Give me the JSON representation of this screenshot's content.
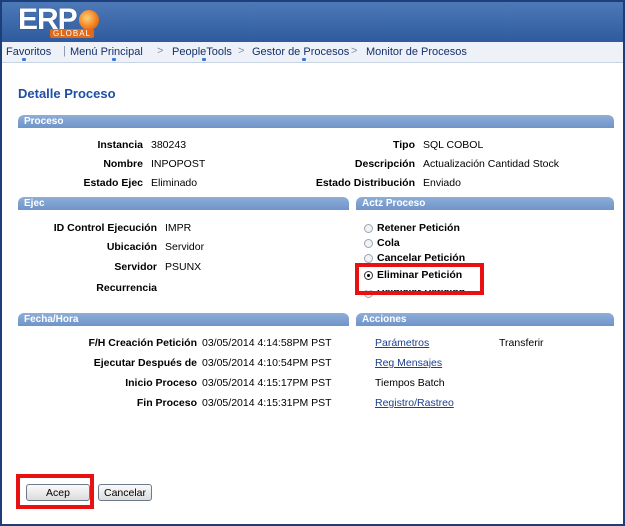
{
  "logo": {
    "text": "ERP",
    "sub": "GLOBAL"
  },
  "breadcrumb": [
    "Favoritos",
    "Menú Principal",
    "PeopleTools",
    "Gestor de Procesos",
    "Monitor de Procesos"
  ],
  "page_title": "Detalle Proceso",
  "proceso": {
    "header": "Proceso",
    "instancia_label": "Instancia",
    "instancia_value": "380243",
    "nombre_label": "Nombre",
    "nombre_value": "INPOPOST",
    "estado_ejec_label": "Estado Ejec",
    "estado_ejec_value": "Eliminado",
    "tipo_label": "Tipo",
    "tipo_value": "SQL COBOL",
    "descripcion_label": "Descripción",
    "descripcion_value": "Actualización Cantidad Stock",
    "estado_dist_label": "Estado Distribución",
    "estado_dist_value": "Enviado"
  },
  "ejec": {
    "header": "Ejec",
    "id_control_label": "ID Control Ejecución",
    "id_control_value": "IMPR",
    "ubicacion_label": "Ubicación",
    "ubicacion_value": "Servidor",
    "servidor_label": "Servidor",
    "servidor_value": "PSUNX",
    "recurrencia_label": "Recurrencia"
  },
  "actz": {
    "header": "Actz Proceso",
    "options": [
      "Retener Petición",
      "Cola",
      "Cancelar Petición",
      "Eliminar Petición",
      "Reiniciar Petición"
    ],
    "selected": "Eliminar Petición"
  },
  "fecha": {
    "header": "Fecha/Hora",
    "creacion_label": "F/H Creación Petición",
    "creacion_value": "03/05/2014 4:14:58PM PST",
    "despues_label": "Ejecutar Después de",
    "despues_value": "03/05/2014 4:10:54PM PST",
    "inicio_label": "Inicio Proceso",
    "inicio_value": "03/05/2014 4:15:17PM PST",
    "fin_label": "Fin Proceso",
    "fin_value": "03/05/2014 4:15:31PM PST"
  },
  "acciones": {
    "header": "Acciones",
    "parametros": "Parámetros",
    "transferir": "Transferir",
    "reg_mensajes": "Reg Mensajes",
    "tiempos_batch": "Tiempos Batch",
    "registro_rastreo": "Registro/Rastreo"
  },
  "buttons": {
    "accept": "Acep",
    "cancel": "Cancelar"
  },
  "colors": {
    "accent": "#1f4ea4",
    "section": "#7a9cce",
    "highlight": "#e81010"
  }
}
